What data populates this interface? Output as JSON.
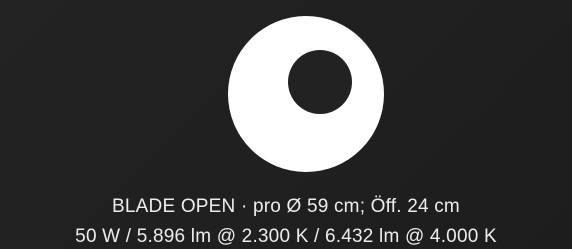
{
  "product": {
    "caption_line1": "BLADE OPEN · pro Ø 59 cm; Öff. 24 cm",
    "caption_line2": "50 W / 5.896 lm @ 2.300 K / 6.432 lm @ 4.000 K"
  },
  "icon": {
    "name": "lamp-ring-icon",
    "fill": "#ffffff",
    "hole": "#222222"
  }
}
